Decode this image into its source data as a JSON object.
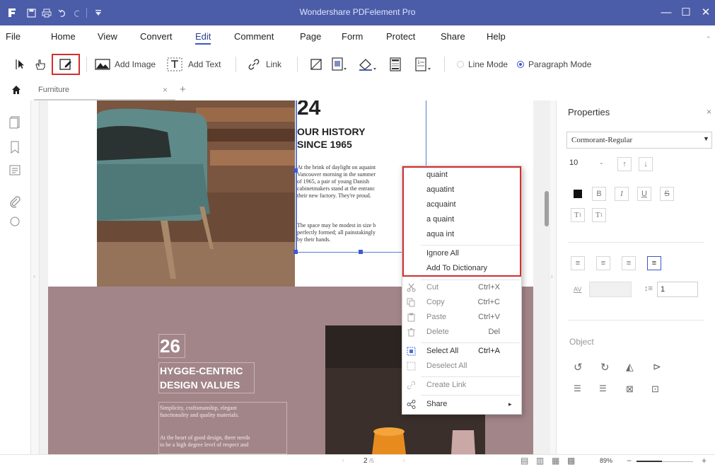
{
  "app": {
    "title": "Wondershare PDFelement Pro",
    "minimize": "—",
    "maximize": "☐",
    "close": "✕"
  },
  "menu": [
    "File",
    "Home",
    "View",
    "Convert",
    "Edit",
    "Comment",
    "Page",
    "Form",
    "Protect",
    "Share",
    "Help"
  ],
  "toolbar": {
    "add_image": "Add Image",
    "add_text": "Add Text",
    "link": "Link",
    "line_mode": "Line Mode",
    "paragraph_mode": "Paragraph Mode",
    "selected_mode": "paragraph"
  },
  "tabs": {
    "document": "Furniture",
    "close": "×",
    "add": "+"
  },
  "document": {
    "section1_number": "24",
    "section1_heading_line1": "OUR HISTORY",
    "section1_heading_line2": "SINCE 1965",
    "para1_lines": [
      "At the brink of daylight on aquaint",
      "Vancouver morning in the summer",
      "of 1965, a pair of young Danish",
      "cabinetmakers stand at the entranc",
      "their new factory. They're proud."
    ],
    "para2_lines": [
      "The space may be modest in size b",
      "perfectly formed; all painstakingly",
      "by their hands."
    ],
    "section2_number": "26",
    "section2_heading_line1": "HYGGE-CENTRIC",
    "section2_heading_line2": "DESIGN VALUES",
    "para3_lines": [
      "Simplicity, craftsmanship, elegant",
      "functionality and quality materials."
    ],
    "para4_lines": [
      "At the heart of good design, there needs",
      "to be a high degree level of respect and"
    ],
    "colors": {
      "mauve": "#a28589",
      "photo_dark": "#3a2f2a",
      "chair_teal": "#5d8c8c",
      "wood": "#8a5a3c"
    }
  },
  "context_menu": {
    "suggestions": [
      "quaint",
      "aquatint",
      "acquaint",
      "a quaint",
      "aqua int"
    ],
    "ignore_all": "Ignore All",
    "add_to_dictionary": "Add To Dictionary",
    "items": [
      {
        "label": "Cut",
        "shortcut": "Ctrl+X",
        "disabled": true
      },
      {
        "label": "Copy",
        "shortcut": "Ctrl+C",
        "disabled": true
      },
      {
        "label": "Paste",
        "shortcut": "Ctrl+V",
        "disabled": true
      },
      {
        "label": "Delete",
        "shortcut": "Del",
        "disabled": true
      },
      {
        "label": "Select All",
        "shortcut": "Ctrl+A",
        "disabled": false
      },
      {
        "label": "Deselect All",
        "shortcut": "",
        "disabled": true
      },
      {
        "label": "Create Link",
        "shortcut": "",
        "disabled": true
      },
      {
        "label": "Share",
        "shortcut": "",
        "disabled": false
      }
    ],
    "submenu_arrow": "▸"
  },
  "properties": {
    "title": "Properties",
    "close": "×",
    "font": "Cormorant-Regular",
    "font_size": "10",
    "bold": "B",
    "italic": "I",
    "underline": "U",
    "strike": "S",
    "superscript": "T",
    "subscript": "T",
    "line_spacing": "1",
    "object_label": "Object",
    "char_spacing_label": "AV"
  },
  "status": {
    "page": "2",
    "total": "/5",
    "zoom": "89%",
    "minus": "−",
    "plus": "+"
  }
}
